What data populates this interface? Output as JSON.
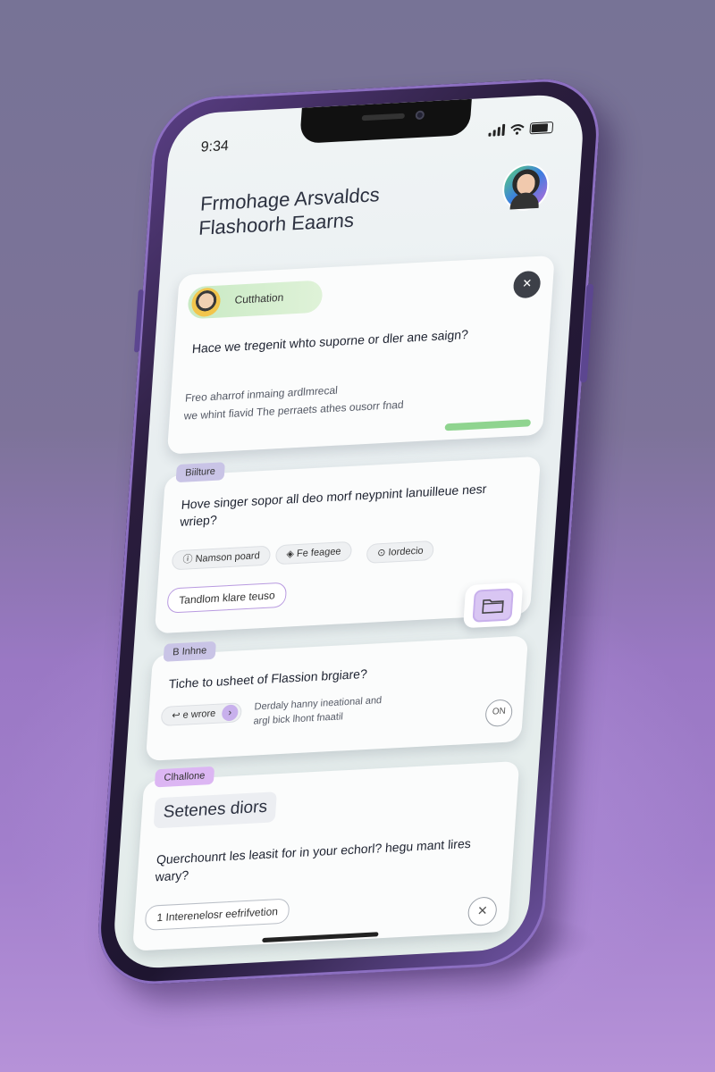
{
  "status": {
    "time": "9:34"
  },
  "header": {
    "line1": "Frmohage Arsvaldcs",
    "line2": "Flashoorh Eaarns"
  },
  "card1": {
    "tag": "Cutthation",
    "question": "Hace we tregenit whto suporne or dler ane saign?",
    "sub1": "Freo aharrof inmaing ardlmrecal",
    "sub2": "we whint fiavid The perraets athes ousorr fnad",
    "close_icon": "close-icon"
  },
  "card2": {
    "tag": "Biilture",
    "question": "Hove singer sopor all deo morf neypnint lanuilleue nesr wriep?",
    "chips": [
      "Namson poard",
      "Fe feagee",
      "Iordecio"
    ],
    "action": "Tandlom klare teuso",
    "folder_icon": "folder-icon"
  },
  "card3": {
    "tag": "B Inhne",
    "question": "Tiche to usheet of Flassion brgiare?",
    "chip": "e wrore",
    "desc1": "Derdaly hanny ineational and",
    "desc2": "argl bick lhont fnaatil",
    "circle_label": "ON"
  },
  "card4": {
    "tag": "Clhallone",
    "title": "Setenes diors",
    "question": "Querchounrt les leasit for in your echorl? hegu mant lires wary?",
    "action": "1 Interenelosr eefrifvetion",
    "close_icon": "close-icon"
  },
  "colors": {
    "accent_purple": "#b89ae0",
    "accent_green": "#8fd48f",
    "background": "#7d7399"
  }
}
